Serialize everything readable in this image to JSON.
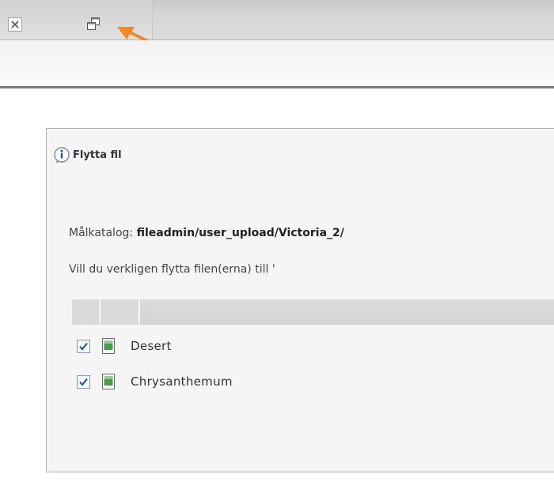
{
  "toolbar": {
    "close_icon": "close-x-icon",
    "open_new_window_icon": "open-in-new-window-icon",
    "annotation": "orange-arrow-pointing-at-new-window-icon",
    "annotation_color": "#f08a24"
  },
  "dialog": {
    "title_icon": "info-icon",
    "title": "Flytta fil",
    "target_label": "Målkatalog:",
    "target_path": "fileadmin/user_upload/Victoria_2/",
    "confirm_text": "Vill du verkligen flytta filen(erna) till '",
    "files": [
      {
        "name": "Desert",
        "checked": true,
        "icon": "image-file-icon"
      },
      {
        "name": "Chrysanthemum",
        "checked": true,
        "icon": "image-file-icon"
      }
    ]
  },
  "colors": {
    "toolbar_bg": "#d6d6d6",
    "panel_bg": "#f5f5f5",
    "checkbox_border": "#7f9db9",
    "checkmark": "#1f4f9a",
    "file_icon_green": "#4a9a4a"
  }
}
